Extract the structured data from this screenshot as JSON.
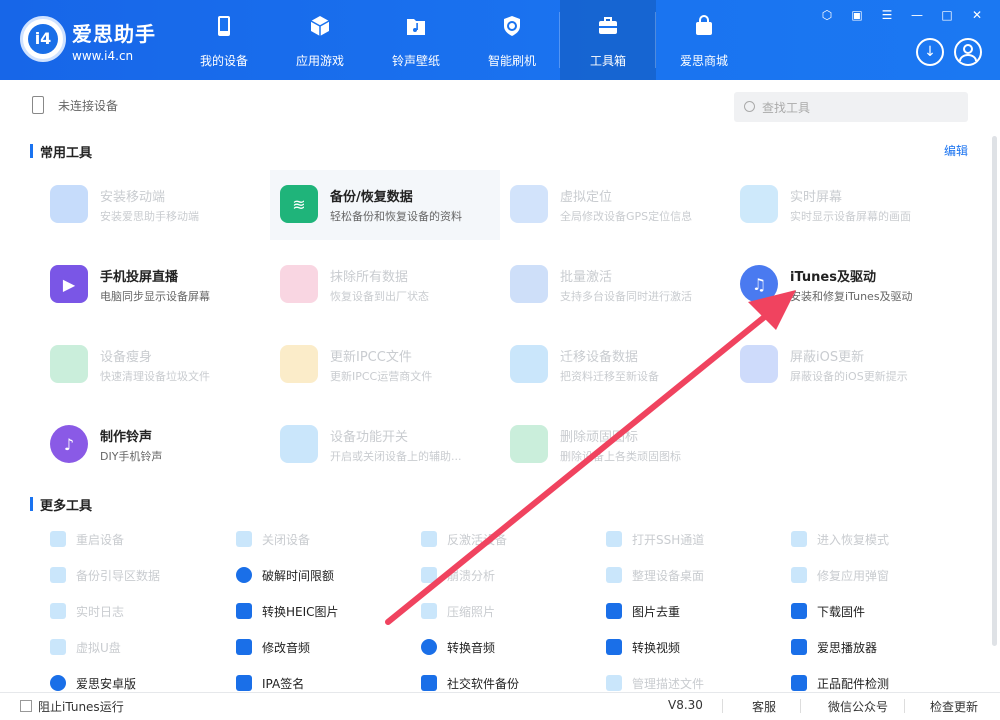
{
  "app": {
    "name": "爱思助手",
    "url": "www.i4.cn",
    "logo_text": "i4"
  },
  "nav": [
    {
      "label": "我的设备",
      "icon": "phone-icon"
    },
    {
      "label": "应用游戏",
      "icon": "cube-icon"
    },
    {
      "label": "铃声壁纸",
      "icon": "music-folder-icon"
    },
    {
      "label": "智能刷机",
      "icon": "refresh-shield-icon"
    },
    {
      "label": "工具箱",
      "icon": "toolbox-icon",
      "active": true
    },
    {
      "label": "爱思商城",
      "icon": "shopping-bag-icon"
    }
  ],
  "device_bar": {
    "status": "未连接设备",
    "search_placeholder": "查找工具"
  },
  "common_tools": {
    "title": "常用工具",
    "edit_label": "编辑",
    "items": [
      {
        "title": "安装移动端",
        "subtitle": "安装爱思助手移动端",
        "enabled": false,
        "icon": "i4-app-icon",
        "color": "#1a73f0"
      },
      {
        "title": "备份/恢复数据",
        "subtitle": "轻松备份和恢复设备的资料",
        "enabled": true,
        "highlight": true,
        "icon": "layers-icon",
        "color": "#1fb47a"
      },
      {
        "title": "虚拟定位",
        "subtitle": "全局修改设备GPS定位信息",
        "enabled": false,
        "icon": "location-pin-icon",
        "color": "#4a8ff0"
      },
      {
        "title": "实时屏幕",
        "subtitle": "实时显示设备屏幕的画面",
        "enabled": false,
        "icon": "screen-mirror-icon",
        "color": "#3aa6f0"
      },
      {
        "title": "手机投屏直播",
        "subtitle": "电脑同步显示设备屏幕",
        "enabled": true,
        "icon": "cast-icon",
        "color": "#7a56e6"
      },
      {
        "title": "抹除所有数据",
        "subtitle": "恢复设备到出厂状态",
        "enabled": false,
        "icon": "eraser-icon",
        "color": "#e85a8a"
      },
      {
        "title": "批量激活",
        "subtitle": "支持多台设备同时进行激活",
        "enabled": false,
        "icon": "batch-activate-icon",
        "color": "#3a7ee8"
      },
      {
        "title": "iTunes及驱动",
        "subtitle": "安装和修复iTunes及驱动",
        "enabled": true,
        "icon": "itunes-icon",
        "color": "#4a7af0"
      },
      {
        "title": "设备瘦身",
        "subtitle": "快速清理设备垃圾文件",
        "enabled": false,
        "icon": "broom-icon",
        "color": "#2bbd6e"
      },
      {
        "title": "更新IPCC文件",
        "subtitle": "更新IPCC运营商文件",
        "enabled": false,
        "icon": "folder-icon",
        "color": "#f0b429"
      },
      {
        "title": "迁移设备数据",
        "subtitle": "把资料迁移至新设备",
        "enabled": false,
        "icon": "migrate-icon",
        "color": "#2a9df0"
      },
      {
        "title": "屏蔽iOS更新",
        "subtitle": "屏蔽设备的iOS更新提示",
        "enabled": false,
        "icon": "block-update-icon",
        "color": "#3a6ef0"
      },
      {
        "title": "制作铃声",
        "subtitle": "DIY手机铃声",
        "enabled": true,
        "icon": "ringtone-icon",
        "color": "#8a5ae6"
      },
      {
        "title": "设备功能开关",
        "subtitle": "开启或关闭设备上的辅助...",
        "enabled": false,
        "icon": "toggles-icon",
        "color": "#2a9df0"
      },
      {
        "title": "删除顽固图标",
        "subtitle": "删除设备上各类顽固图标",
        "enabled": false,
        "icon": "delete-icon-icon",
        "color": "#2bbd6e"
      }
    ]
  },
  "more_tools": {
    "title": "更多工具",
    "items": [
      {
        "label": "重启设备",
        "enabled": false,
        "icon": "restart-icon",
        "color": "#2a9df0"
      },
      {
        "label": "关闭设备",
        "enabled": false,
        "icon": "power-icon",
        "color": "#2a9df0"
      },
      {
        "label": "反激活设备",
        "enabled": false,
        "icon": "deactivate-icon",
        "color": "#2a9df0"
      },
      {
        "label": "打开SSH通道",
        "enabled": false,
        "icon": "ssh-icon",
        "color": "#2a9df0"
      },
      {
        "label": "进入恢复模式",
        "enabled": false,
        "icon": "recovery-icon",
        "color": "#2a9df0"
      },
      {
        "label": "备份引导区数据",
        "enabled": false,
        "icon": "boot-backup-icon",
        "color": "#2a9df0"
      },
      {
        "label": "破解时间限额",
        "enabled": true,
        "icon": "clock-icon",
        "color": "#1a6fe8"
      },
      {
        "label": "崩溃分析",
        "enabled": false,
        "icon": "crash-analysis-icon",
        "color": "#2a9df0"
      },
      {
        "label": "整理设备桌面",
        "enabled": false,
        "icon": "desktop-grid-icon",
        "color": "#2a9df0"
      },
      {
        "label": "修复应用弹窗",
        "enabled": false,
        "icon": "fix-popup-icon",
        "color": "#2a9df0"
      },
      {
        "label": "实时日志",
        "enabled": false,
        "icon": "log-icon",
        "color": "#2a9df0"
      },
      {
        "label": "转换HEIC图片",
        "enabled": true,
        "icon": "heic-convert-icon",
        "color": "#1a6fe8"
      },
      {
        "label": "压缩照片",
        "enabled": false,
        "icon": "compress-photo-icon",
        "color": "#2a9df0"
      },
      {
        "label": "图片去重",
        "enabled": true,
        "icon": "image-dedupe-icon",
        "color": "#1a6fe8"
      },
      {
        "label": "下载固件",
        "enabled": true,
        "icon": "firmware-download-icon",
        "color": "#1a6fe8"
      },
      {
        "label": "虚拟U盘",
        "enabled": false,
        "icon": "usb-drive-icon",
        "color": "#2a9df0"
      },
      {
        "label": "修改音频",
        "enabled": true,
        "icon": "audio-edit-icon",
        "color": "#1a6fe8"
      },
      {
        "label": "转换音频",
        "enabled": true,
        "icon": "audio-convert-icon",
        "color": "#1a6fe8"
      },
      {
        "label": "转换视频",
        "enabled": true,
        "icon": "video-convert-icon",
        "color": "#1a6fe8"
      },
      {
        "label": "爱思播放器",
        "enabled": true,
        "icon": "player-icon",
        "color": "#1a6fe8"
      },
      {
        "label": "爱思安卓版",
        "enabled": true,
        "icon": "i4-android-icon",
        "color": "#1a6fe8"
      },
      {
        "label": "IPA签名",
        "enabled": true,
        "icon": "ipa-sign-icon",
        "color": "#1a6fe8"
      },
      {
        "label": "社交软件备份",
        "enabled": true,
        "icon": "social-backup-icon",
        "color": "#1a6fe8"
      },
      {
        "label": "管理描述文件",
        "enabled": false,
        "icon": "profile-manage-icon",
        "color": "#2a9df0"
      },
      {
        "label": "正品配件检测",
        "enabled": true,
        "icon": "accessory-check-icon",
        "color": "#1a6fe8"
      }
    ]
  },
  "footer": {
    "block_itunes": "阻止iTunes运行",
    "version": "V8.30",
    "service": "客服",
    "wechat": "微信公众号",
    "update": "检查更新"
  },
  "colors": {
    "header_blue": "#1a73f0",
    "arrow_red": "#f0435f"
  }
}
